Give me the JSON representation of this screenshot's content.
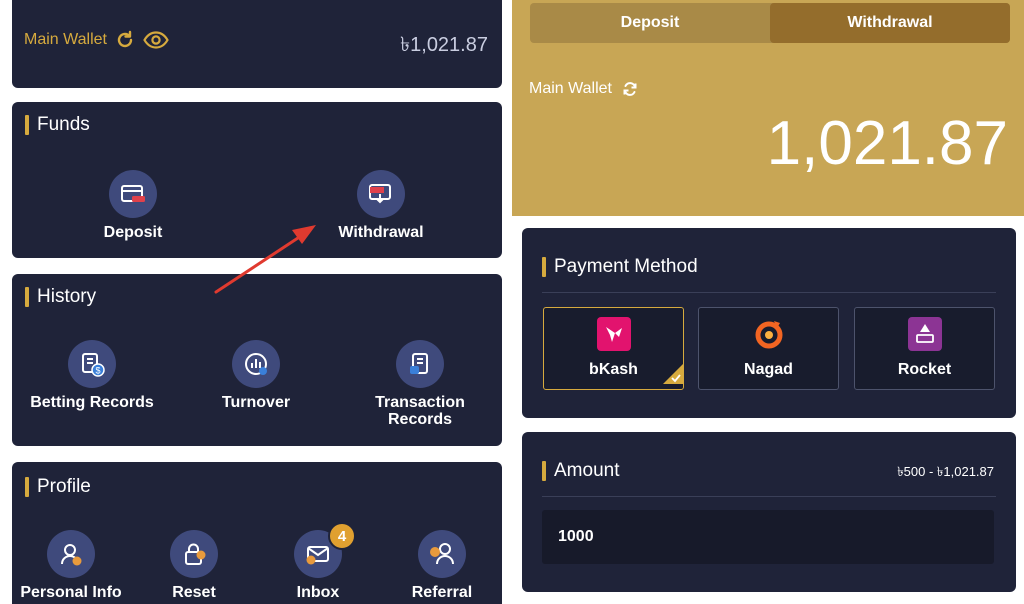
{
  "wallet": {
    "label": "Main Wallet",
    "balance": "৳1,021.87"
  },
  "funds": {
    "title": "Funds",
    "items": [
      {
        "label": "Deposit",
        "icon": "deposit-card-icon"
      },
      {
        "label": "Withdrawal",
        "icon": "withdrawal-card-icon"
      }
    ]
  },
  "history": {
    "title": "History",
    "items": [
      {
        "label": "Betting Records",
        "icon": "betting-records-icon"
      },
      {
        "label": "Turnover",
        "icon": "turnover-icon"
      },
      {
        "label": "Transaction\nRecords",
        "icon": "transaction-records-icon"
      }
    ]
  },
  "profile": {
    "title": "Profile",
    "items": [
      {
        "label": "Personal Info",
        "icon": "personal-info-icon"
      },
      {
        "label": "Reset",
        "icon": "reset-lock-icon"
      },
      {
        "label": "Inbox",
        "icon": "inbox-icon",
        "badge": "4"
      },
      {
        "label": "Referral",
        "icon": "referral-icon"
      }
    ]
  },
  "tabs": [
    {
      "label": "Deposit",
      "active": false
    },
    {
      "label": "Withdrawal",
      "active": true
    }
  ],
  "panel": {
    "wallet_label": "Main Wallet",
    "balance": "1,021.87"
  },
  "payment": {
    "title": "Payment Method",
    "options": [
      {
        "name": "bKash",
        "selected": true
      },
      {
        "name": "Nagad",
        "selected": false
      },
      {
        "name": "Rocket",
        "selected": false
      }
    ]
  },
  "amount": {
    "title": "Amount",
    "range": "৳500 - ৳1,021.87",
    "value": "1000"
  },
  "colors": {
    "accent": "#d6aa3e",
    "card_bg": "#1f2339",
    "gold_panel": "#c8a655",
    "badge": "#e0a030",
    "arrow": "#e03a2f"
  }
}
